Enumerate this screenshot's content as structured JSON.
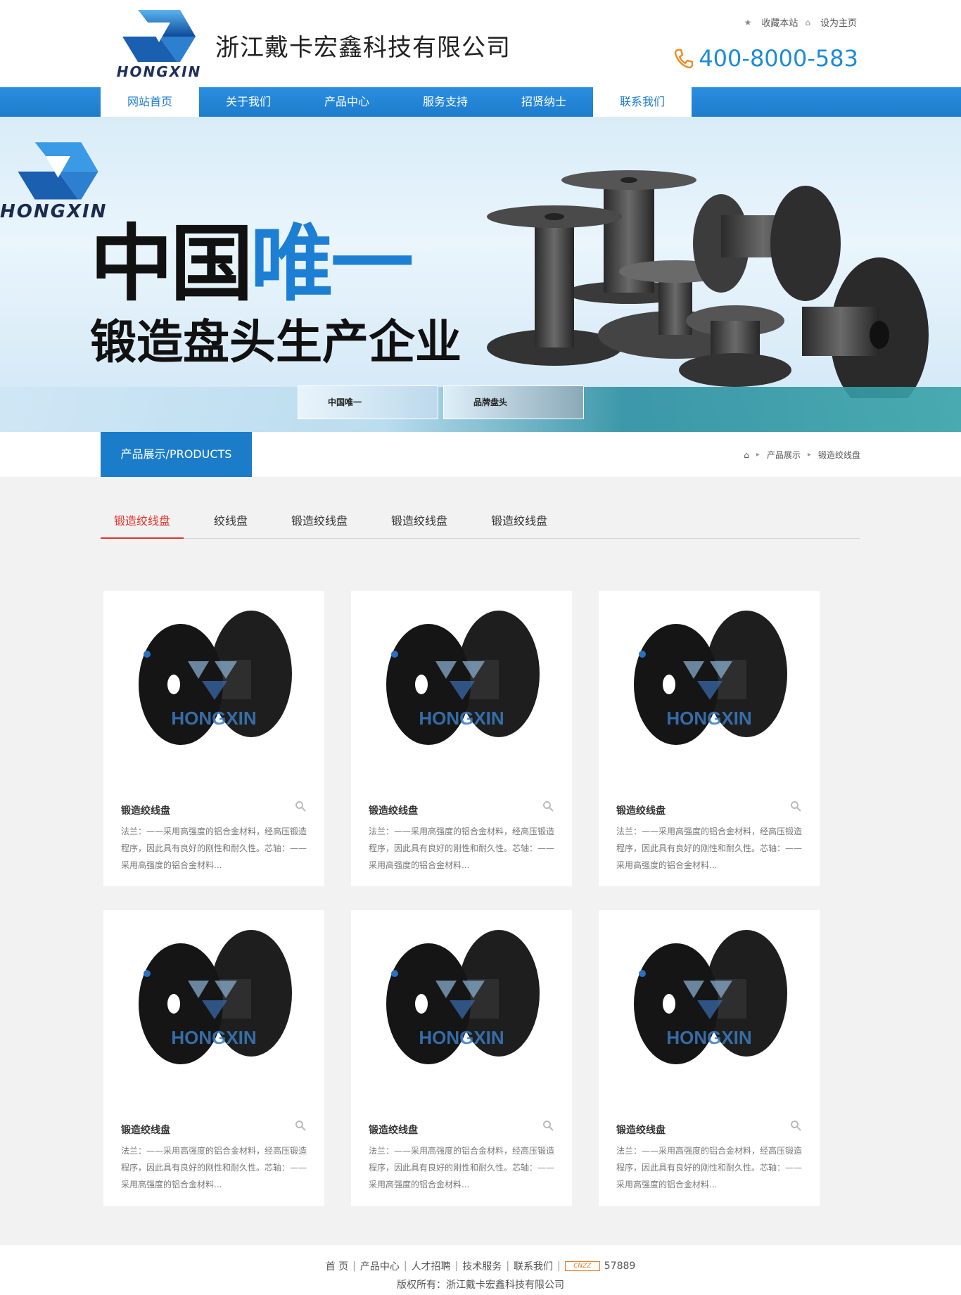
{
  "header": {
    "logo_text": "HONGXIN",
    "company_name": "浙江戴卡宏鑫科技有限公司",
    "bookmark_label": "收藏本站",
    "homepage_label": "设为主页",
    "phone": "400-8000-583"
  },
  "nav": [
    {
      "label": "网站首页"
    },
    {
      "label": "关于我们"
    },
    {
      "label": "产品中心"
    },
    {
      "label": "服务支持"
    },
    {
      "label": "招贤纳士"
    },
    {
      "label": "联系我们"
    }
  ],
  "banner": {
    "logo_text": "HONGXIN",
    "headline_black": "中国",
    "headline_blue": "唯一",
    "subline": "锻造盘头生产企业",
    "thumb1_text": "中国唯一",
    "thumb2_text": "品牌盘头"
  },
  "section": {
    "title": "产品展示/PRODUCTS",
    "breadcrumb": [
      "产品展示",
      "锻造绞线盘"
    ]
  },
  "tabs": [
    "锻造绞线盘",
    "绞线盘",
    "锻造绞线盘",
    "锻造绞线盘",
    "锻造绞线盘"
  ],
  "products": [
    {
      "title": "锻造绞线盘",
      "desc": "法兰：——采用高强度的铝合金材料，经高压锻造程序，因此具有良好的刚性和耐久性。芯轴：——采用高强度的铝合金材料..."
    },
    {
      "title": "锻造绞线盘",
      "desc": "法兰：——采用高强度的铝合金材料，经高压锻造程序，因此具有良好的刚性和耐久性。芯轴：——采用高强度的铝合金材料..."
    },
    {
      "title": "锻造绞线盘",
      "desc": "法兰：——采用高强度的铝合金材料，经高压锻造程序，因此具有良好的刚性和耐久性。芯轴：——采用高强度的铝合金材料..."
    },
    {
      "title": "锻造绞线盘",
      "desc": "法兰：——采用高强度的铝合金材料，经高压锻造程序，因此具有良好的刚性和耐久性。芯轴：——采用高强度的铝合金材料..."
    },
    {
      "title": "锻造绞线盘",
      "desc": "法兰：——采用高强度的铝合金材料，经高压锻造程序，因此具有良好的刚性和耐久性。芯轴：——采用高强度的铝合金材料..."
    },
    {
      "title": "锻造绞线盘",
      "desc": "法兰：——采用高强度的铝合金材料，经高压锻造程序，因此具有良好的刚性和耐久性。芯轴：——采用高强度的铝合金材料..."
    }
  ],
  "product_watermark": "HONGXIN",
  "footer": {
    "links": [
      "首 页",
      "产品中心",
      "人才招聘",
      "技术服务",
      "联系我们"
    ],
    "counter_badge": "CNZZ",
    "counter": "57889",
    "copyright": "版权所有：浙江戴卡宏鑫科技有限公司"
  },
  "colors": {
    "brand_blue": "#1e7ccc",
    "active_tab": "#e0332a",
    "phone": "#1d8bd6"
  }
}
